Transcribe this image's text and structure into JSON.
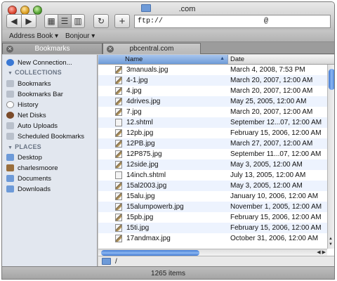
{
  "window": {
    "title": ".com"
  },
  "toolbar": {
    "back_label": "◀",
    "forward_label": "▶",
    "view_icons_label": "▦",
    "view_list_label": "☰",
    "view_columns_label": "▥",
    "refresh_label": "↻",
    "new_label": "+",
    "address_value": "ftp://                        @                   /"
  },
  "bookmarks_bar": {
    "items": [
      "Address Book ▾",
      "Bonjour ▾"
    ]
  },
  "tabs": [
    {
      "label": "Bookmarks",
      "active": true
    },
    {
      "label": "pbcentral.com",
      "active": false
    }
  ],
  "sidebar": {
    "new_connection": "New Connection...",
    "collections_header": "COLLECTIONS",
    "collections": [
      "Bookmarks",
      "Bookmarks Bar",
      "History",
      "Net Disks",
      "Auto Uploads",
      "Scheduled Bookmarks"
    ],
    "places_header": "PLACES",
    "places": [
      "Desktop",
      "charlesmoore",
      "Documents",
      "Downloads"
    ]
  },
  "list": {
    "col_name": "Name",
    "col_date": "Date",
    "rows": [
      {
        "name": "3manuals.jpg",
        "date": "March 4, 2008, 7:53 PM",
        "type": "img"
      },
      {
        "name": "4-1.jpg",
        "date": "March 20, 2007, 12:00 AM",
        "type": "img"
      },
      {
        "name": "4.jpg",
        "date": "March 20, 2007, 12:00 AM",
        "type": "img"
      },
      {
        "name": "4drives.jpg",
        "date": "May 25, 2005, 12:00 AM",
        "type": "img"
      },
      {
        "name": "7.jpg",
        "date": "March 20, 2007, 12:00 AM",
        "type": "img"
      },
      {
        "name": "12.shtml",
        "date": "September 12...07, 12:00 AM",
        "type": "doc"
      },
      {
        "name": "12pb.jpg",
        "date": "February 15, 2006, 12:00 AM",
        "type": "img"
      },
      {
        "name": "12PB.jpg",
        "date": "March 27, 2007, 12:00 AM",
        "type": "img"
      },
      {
        "name": "12P875.jpg",
        "date": "September 11...07, 12:00 AM",
        "type": "img"
      },
      {
        "name": "12side.jpg",
        "date": "May 3, 2005, 12:00 AM",
        "type": "img"
      },
      {
        "name": "14inch.shtml",
        "date": "July 13, 2005, 12:00 AM",
        "type": "doc"
      },
      {
        "name": "15al2003.jpg",
        "date": "May 3, 2005, 12:00 AM",
        "type": "img"
      },
      {
        "name": "15alu.jpg",
        "date": "January 10, 2006, 12:00 AM",
        "type": "img"
      },
      {
        "name": "15alumpowerb.jpg",
        "date": "November 1, 2005, 12:00 AM",
        "type": "img"
      },
      {
        "name": "15pb.jpg",
        "date": "February 15, 2006, 12:00 AM",
        "type": "img"
      },
      {
        "name": "15ti.jpg",
        "date": "February 15, 2006, 12:00 AM",
        "type": "img"
      },
      {
        "name": "17andmax.jpg",
        "date": "October 31, 2006, 12:00 AM",
        "type": "img"
      }
    ]
  },
  "pathbar": {
    "path": "/"
  },
  "status": {
    "count": "1265 items"
  }
}
